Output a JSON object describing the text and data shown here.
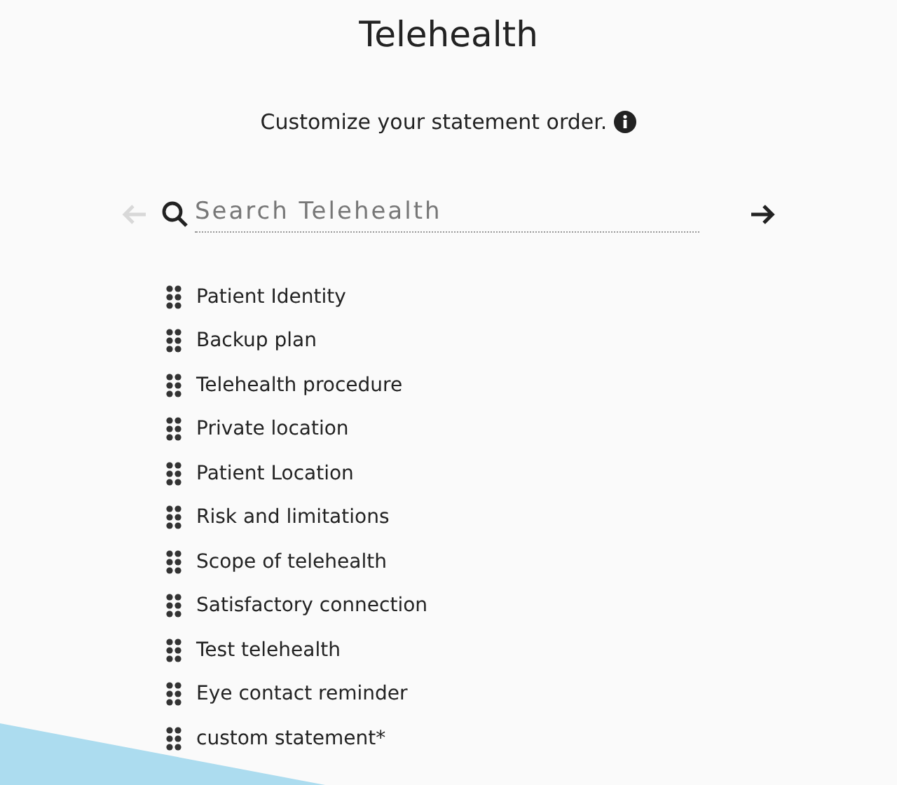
{
  "title": "Telehealth",
  "instruction": "Customize your statement order.",
  "search": {
    "placeholder": "Search Telehealth"
  },
  "nav": {
    "back": {
      "disabled": true
    },
    "forward": {
      "disabled": false
    }
  },
  "statements": [
    {
      "label": "Patient Identity"
    },
    {
      "label": "Backup plan"
    },
    {
      "label": "Telehealth procedure"
    },
    {
      "label": "Private location"
    },
    {
      "label": "Patient Location"
    },
    {
      "label": "Risk and limitations"
    },
    {
      "label": "Scope of telehealth"
    },
    {
      "label": "Satisfactory connection"
    },
    {
      "label": "Test telehealth"
    },
    {
      "label": "Eye contact reminder"
    },
    {
      "label": "custom statement*"
    }
  ]
}
